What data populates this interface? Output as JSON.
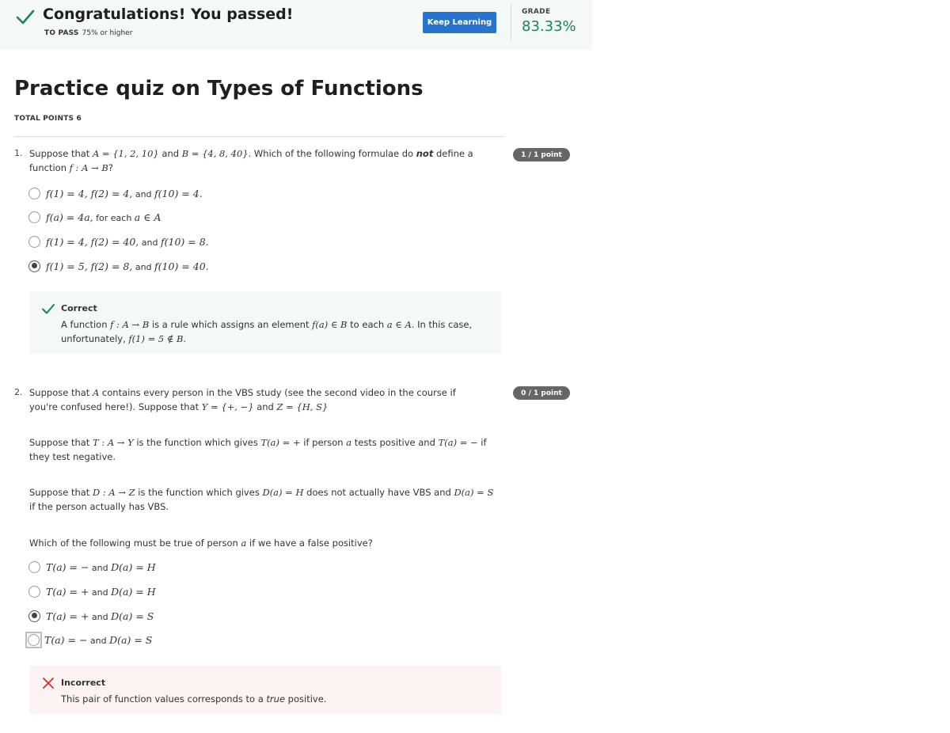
{
  "banner": {
    "title": "Congratulations! You passed!",
    "to_pass_label": "TO PASS",
    "to_pass_value": "75% or higher",
    "keep_learning": "Keep Learning",
    "grade_label": "GRADE",
    "grade_value": "83.33%"
  },
  "quiz": {
    "title": "Practice quiz on Types of Functions",
    "total_points": "TOTAL POINTS 6"
  },
  "questions": [
    {
      "number": "1.",
      "points": "1 / 1 point",
      "text_parts": [
        "Suppose that ",
        "A = {1, 2, 10}",
        " and ",
        "B = {4, 8, 40}",
        ". Which of the following formulae do ",
        "not",
        " define a ",
        "function ",
        "f : A → B",
        "?"
      ],
      "options": [
        {
          "math1": "f(1) = 4, f(2) = 4,",
          "and": " and ",
          "math2": "f(10) = 4.",
          "selected": false
        },
        {
          "math1": "f(a) = 4a,",
          "and": " for each ",
          "math2": "a ∈ A",
          "selected": false
        },
        {
          "math1": "f(1) = 4, f(2) = 40,",
          "and": " and ",
          "math2": "f(10) = 8.",
          "selected": false
        },
        {
          "math1": "f(1) = 5, f(2) = 8,",
          "and": " and ",
          "math2": "f(10) = 40.",
          "selected": true
        }
      ],
      "feedback": {
        "status": "Correct",
        "parts": [
          "A function ",
          "f : A → B",
          " is a rule which assigns an element ",
          "f(a) ∈ B",
          " to each ",
          "a ∈ A",
          ". In this case, unfortunately, ",
          "f(1) = 5 ∉ B",
          "."
        ]
      }
    },
    {
      "number": "2.",
      "points": "0 / 1 point",
      "p1": [
        "Suppose that ",
        "A",
        " contains every person in the VBS study (see the second video in the course if you're confused here!). Suppose that ",
        "Y = {+, −}",
        " and ",
        "Z = {H, S}"
      ],
      "p2": [
        "Suppose that ",
        "T : A → Y",
        " is the function which gives ",
        "T(a) = +",
        " if person ",
        "a",
        " tests positive and ",
        "T(a) = −",
        " if they test negative."
      ],
      "p3": [
        "Suppose that ",
        "D : A → Z",
        " is the function which gives ",
        "D(a) = H",
        " does not actually have VBS and ",
        "D(a) = S",
        " if the person actually has VBS."
      ],
      "p4": [
        "Which of the following must be true of person ",
        "a",
        " if we have a false positive?"
      ],
      "options": [
        {
          "math1": "T(a) = −",
          "and": " and ",
          "math2": "D(a) = H",
          "selected": false
        },
        {
          "math1": "T(a) = +",
          "and": " and ",
          "math2": "D(a) = H",
          "selected": false
        },
        {
          "math1": "T(a) = +",
          "and": " and ",
          "math2": "D(a) = S",
          "selected": true
        },
        {
          "math1": "T(a) = −",
          "and": " and ",
          "math2": "D(a) = S",
          "selected": false
        }
      ],
      "feedback": {
        "status": "Incorrect",
        "parts": [
          "This pair of function values corresponds to a ",
          "true",
          " positive."
        ]
      }
    }
  ],
  "colors": {
    "success_green": "#1f8354",
    "primary_blue": "#2a73cc",
    "error_red": "#d32f2f"
  }
}
